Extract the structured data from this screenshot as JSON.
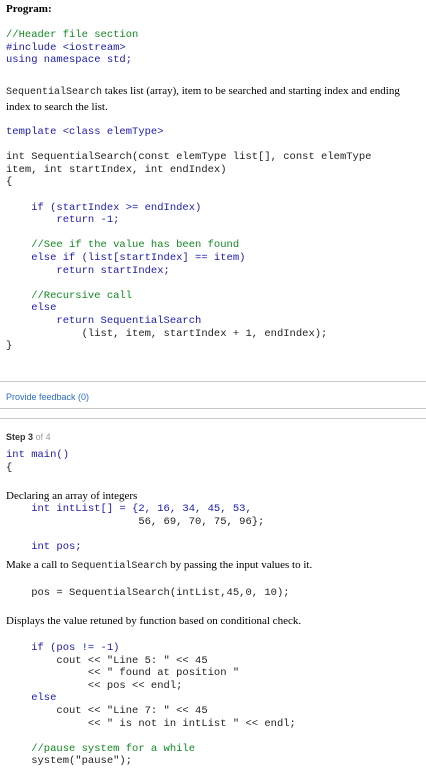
{
  "program_title": "Program:",
  "code1": [
    "//Header file section",
    "#include <iostream>",
    "using namespace std;"
  ],
  "explain_code": "SequentialSearch",
  "explain_text": " takes list (array), item to be searched and starting index and ending index to search the list.",
  "code2": [
    "template <class elemType>",
    "",
    "int SequentialSearch(const elemType list[], const elemType",
    "item, int startIndex, int endIndex)",
    "{",
    "",
    "    if (startIndex >= endIndex)",
    "        return -1;",
    "",
    "    //See if the value has been found",
    "    else if (list[startIndex] == item)",
    "        return startIndex;",
    "",
    "    //Recursive call",
    "    else",
    "        return SequentialSearch",
    "            (list, item, startIndex + 1, endIndex);",
    "}"
  ],
  "feedback_label": "Provide feedback (0)",
  "step": {
    "prefix": "Step",
    "number": "3",
    "suffix": "of 4"
  },
  "code3": [
    "int main()",
    "{"
  ],
  "declare_text": "Declaring an array of integers",
  "code4": [
    "    int intList[] = {2, 16, 34, 45, 53,",
    "                     56, 69, 70, 75, 96};",
    "",
    "    int pos;"
  ],
  "call_text": "Make a call to ",
  "call_code": "SequentialSearch",
  "call_text2": " by passing the input values to it.",
  "code5": "    pos = SequentialSearch(intList,45,0, 10);",
  "display_text": "Displays the value retuned by function based on conditional check.",
  "code6": [
    "    if (pos != -1)",
    "        cout << \"Line 5: \" << 45",
    "             << \" found at position \"",
    "             << pos << endl;",
    "    else",
    "        cout << \"Line 7: \" << 45",
    "             << \" is not in intList \" << endl;",
    "",
    "    //pause system for a while",
    "    system(\"pause\");"
  ]
}
